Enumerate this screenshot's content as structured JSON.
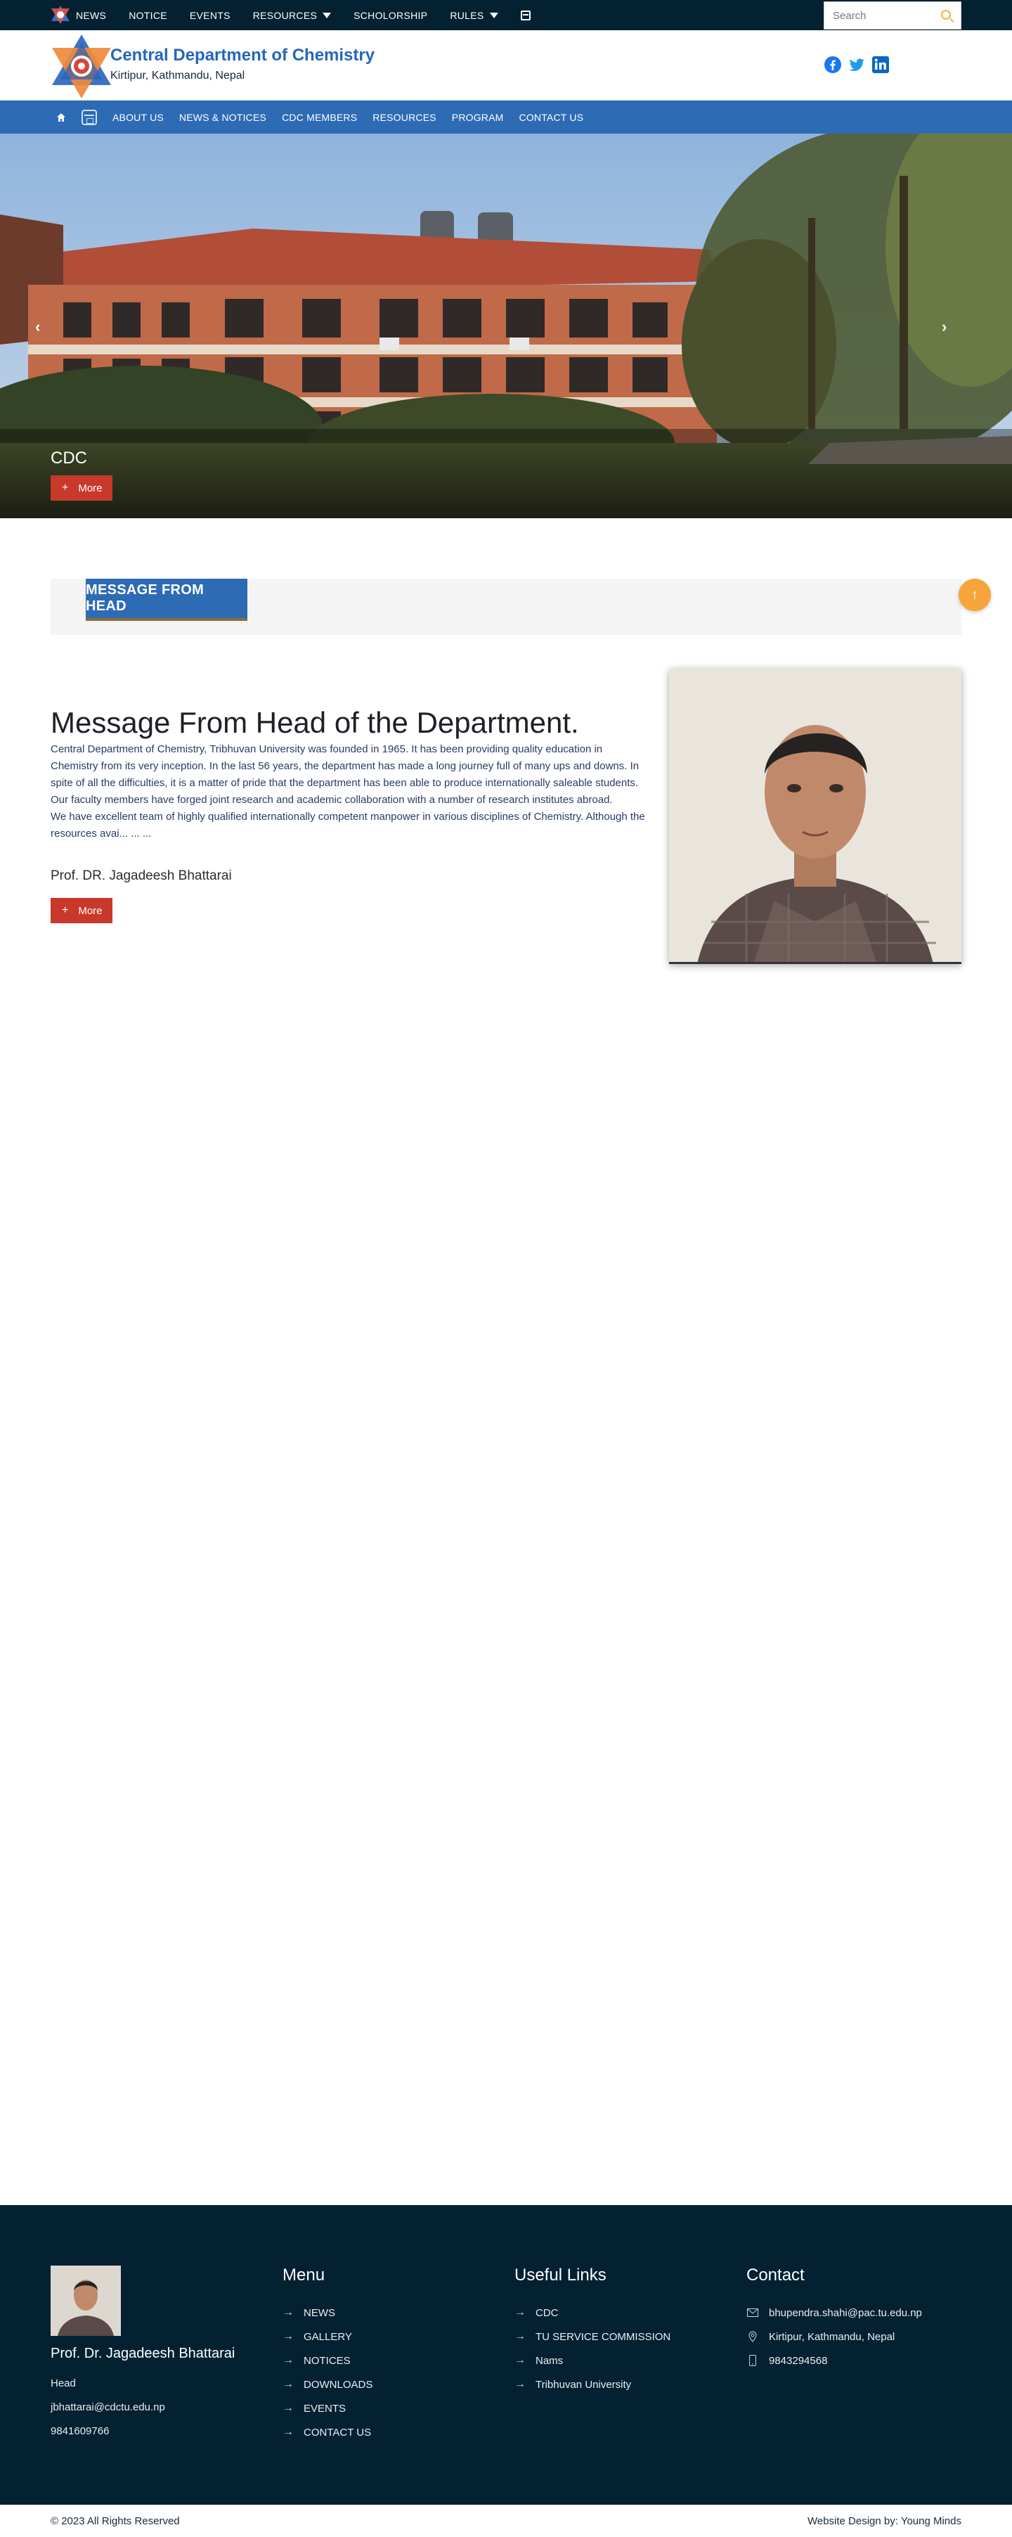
{
  "topbar": {
    "items": [
      {
        "label": "NEWS"
      },
      {
        "label": "NOTICE"
      },
      {
        "label": "EVENTS"
      },
      {
        "label": "RESOURCES"
      },
      {
        "label": "SCHOLORSHIP"
      },
      {
        "label": "RULES"
      }
    ],
    "search_placeholder": "Search"
  },
  "header": {
    "title": "Central Department of Chemistry",
    "subtitle": "Kirtipur, Kathmandu, Nepal",
    "social": [
      "facebook-icon",
      "twitter-icon",
      "linkedin-icon"
    ]
  },
  "mainnav": {
    "items": [
      {
        "label": "ABOUT US"
      },
      {
        "label": "NEWS & NOTICES"
      },
      {
        "label": "CDC MEMBERS"
      },
      {
        "label": "RESOURCES"
      },
      {
        "label": "PROGRAM"
      },
      {
        "label": "CONTACT US"
      }
    ]
  },
  "hero": {
    "caption": "CDC",
    "more_label": "More",
    "prev_icon": "‹",
    "next_icon": "›"
  },
  "message": {
    "section_tag": "MESSAGE FROM HEAD",
    "title": "Message From Head of the Department.",
    "paragraph1": "Central Department of Chemistry, Tribhuvan University was founded in 1965. It has been providing quality education in Chemistry from its very inception. In the last 56 years, the department has made a long journey full of many ups and downs. In spite of all the difficulties, it is a matter of pride that the department has been able to produce internationally saleable students. Our faculty members have forged joint research and academic collaboration with a number of research institutes abroad.",
    "paragraph2": "We have excellent team of highly qualified internationally competent manpower in various disciplines of Chemistry. Although the resources avai... ... ...",
    "signature": "Prof. DR. Jagadeesh Bhattarai",
    "more_label": "More"
  },
  "footer": {
    "profile": {
      "name": "Prof. Dr. Jagadeesh Bhattarai",
      "role": "Head",
      "email": "jbhattarai@cdctu.edu.np",
      "phone": "9841609766"
    },
    "menu": {
      "heading": "Menu",
      "items": [
        "NEWS",
        "GALLERY",
        "NOTICES",
        "DOWNLOADS",
        "EVENTS",
        "CONTACT US"
      ]
    },
    "useful": {
      "heading": "Useful Links",
      "items": [
        "CDC",
        "TU SERVICE COMMISSION",
        "Nams",
        "Tribhuvan University"
      ]
    },
    "contact": {
      "heading": "Contact",
      "email": "bhupendra.shahi@pac.tu.edu.np",
      "address": "Kirtipur, Kathmandu, Nepal",
      "phone": "9843294568"
    },
    "copyright": "© 2023 All Rights Reserved",
    "credit": "Website Design by: Young Minds"
  },
  "colors": {
    "topbar": "#042131",
    "nav": "#2d6bb5",
    "accent_button": "#c8392b",
    "to_top": "#f6a53b",
    "title_blue": "#2467b9"
  }
}
